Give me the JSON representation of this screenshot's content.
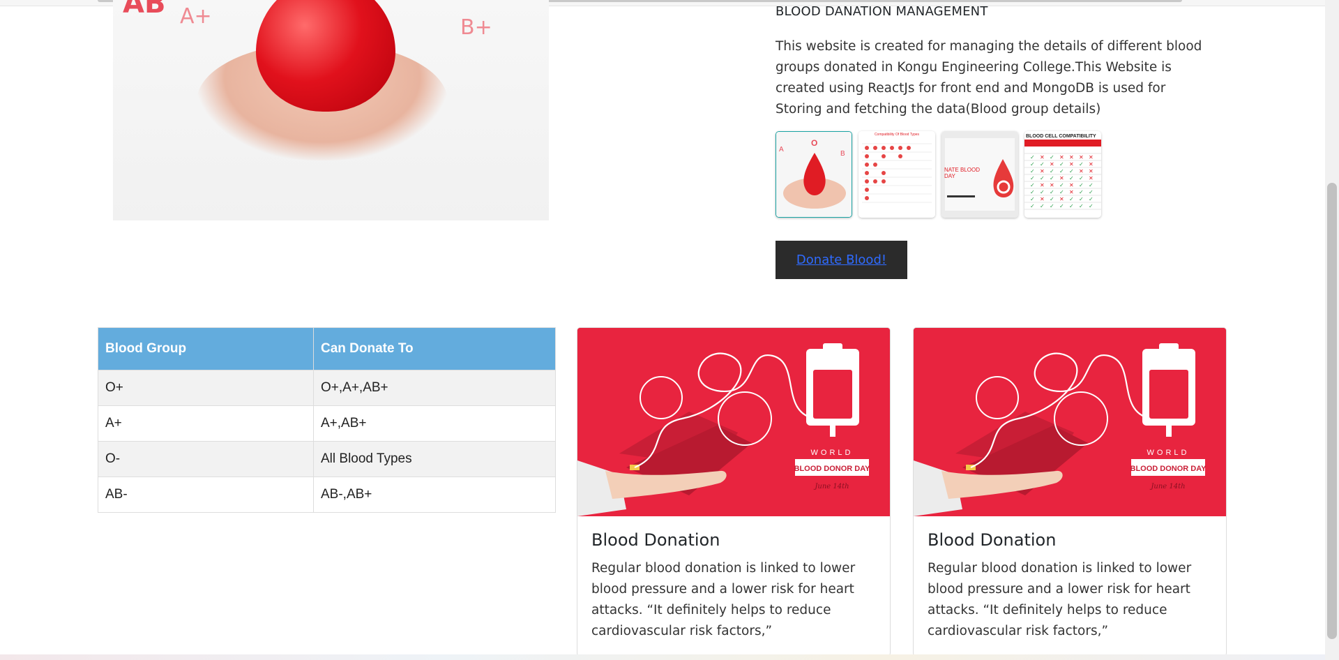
{
  "hero": {
    "labels": [
      "AB",
      "A+",
      "B+"
    ]
  },
  "info": {
    "title": "BLOOD DANATION MANAGEMENT",
    "description": "This website is created for managing the details of different blood groups donated in Kongu Engineering College.This Website is created using ReactJs for front end and MongoDB is used for Storing and fetching the data(Blood group details)"
  },
  "thumbnails": [
    {
      "name": "blood-drop-hands-thumbnail",
      "caption": ""
    },
    {
      "name": "compatibility-chart-thumbnail",
      "caption": "Compatibility Of Blood Types"
    },
    {
      "name": "donate-blood-day-thumbnail",
      "caption": "NATE BLOOD DAY"
    },
    {
      "name": "blood-cell-compatibility-thumbnail",
      "caption": "BLOOD CELL COMPATIBILITY"
    }
  ],
  "donate_button": {
    "label": "Donate Blood!"
  },
  "table": {
    "headers": [
      "Blood Group",
      "Can Donate To"
    ],
    "rows": [
      [
        "O+",
        "O+,A+,AB+"
      ],
      [
        "A+",
        "A+,AB+"
      ],
      [
        "O-",
        "All Blood Types"
      ],
      [
        "AB-",
        "AB-,AB+"
      ]
    ]
  },
  "cards": [
    {
      "image_text_top": "WORLD",
      "image_text_banner": "BLOOD DONOR DAY",
      "image_text_script": "June 14th",
      "title": "Blood Donation",
      "body": "Regular blood donation is linked to lower blood pressure and a lower risk for heart attacks. “It definitely helps to reduce cardiovascular risk factors,”"
    },
    {
      "image_text_top": "WORLD",
      "image_text_banner": "BLOOD DONOR DAY",
      "image_text_script": "June 14th",
      "title": "Blood Donation",
      "body": "Regular blood donation is linked to lower blood pressure and a lower risk for heart attacks. “It definitely helps to reduce cardiovascular risk factors,”"
    }
  ],
  "colors": {
    "table_header": "#63acdd",
    "card_image_bg": "#e8243f",
    "button_bg": "#2b2b2b",
    "link": "#2f6bff"
  }
}
